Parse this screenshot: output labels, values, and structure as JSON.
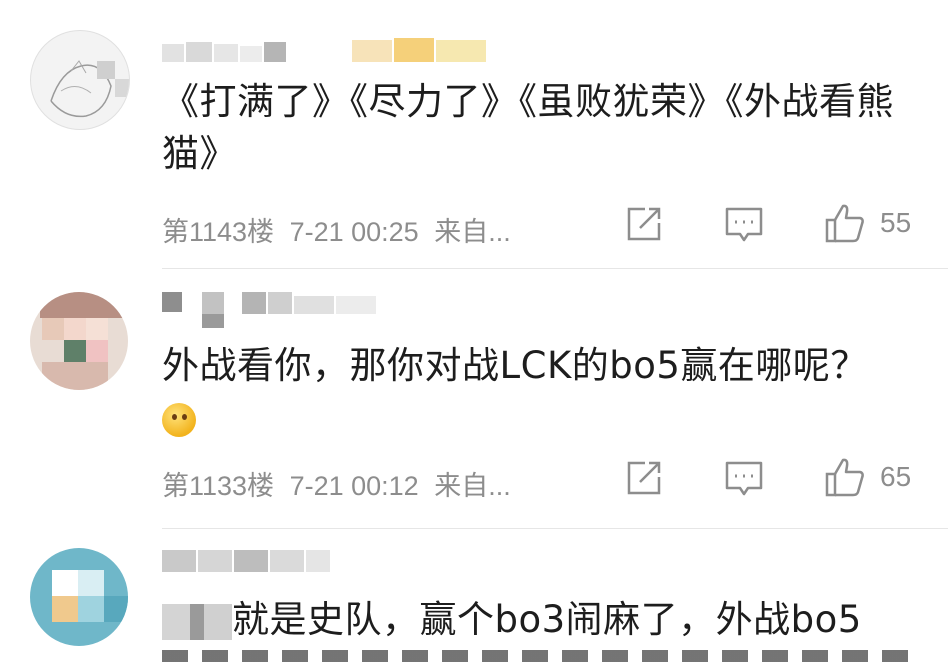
{
  "comments": [
    {
      "text": "《打满了》《尽力了》《虽败犹荣》《外战看熊猫》",
      "floor": "第1143楼",
      "time": "7-21 00:25",
      "source": "来自...",
      "likes": "55"
    },
    {
      "text": "外战看你，那你对战LCK的bo5赢在哪呢？",
      "floor": "第1133楼",
      "time": "7-21 00:12",
      "source": "来自...",
      "likes": "65"
    },
    {
      "text_visible": "就是史队，赢个bo3闹麻了，外战bo5"
    }
  ],
  "icons": {
    "share": "share-icon",
    "reply": "comment-icon",
    "like": "thumbs-up-icon"
  },
  "colors": {
    "meta_gray": "#8d8d8d",
    "text": "#1d1d1d",
    "divider": "#e6e6e6"
  }
}
